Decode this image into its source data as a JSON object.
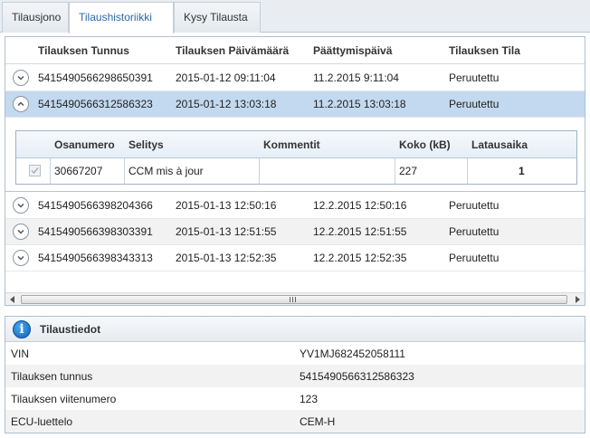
{
  "tabs": [
    {
      "label": "Tilausjono"
    },
    {
      "label": "Tilaushistoriikki"
    },
    {
      "label": "Kysy Tilausta"
    }
  ],
  "grid": {
    "columns": [
      "Tilauksen Tunnus",
      "Tilauksen Päivämäärä",
      "Päättymispäivä",
      "Tilauksen Tila"
    ],
    "rows": [
      {
        "id": "5415490566298650391",
        "date": "2015-01-12 09:11:04",
        "end": "11.2.2015 9:11:04",
        "status": "Peruutettu"
      },
      {
        "id": "5415490566312586323",
        "date": "2015-01-12 13:03:18",
        "end": "11.2.2015 13:03:18",
        "status": "Peruutettu"
      },
      {
        "id": "5415490566398204366",
        "date": "2015-01-13 12:50:16",
        "end": "12.2.2015 12:50:16",
        "status": "Peruutettu"
      },
      {
        "id": "5415490566398303391",
        "date": "2015-01-13 12:51:55",
        "end": "12.2.2015 12:51:55",
        "status": "Peruutettu"
      },
      {
        "id": "5415490566398343313",
        "date": "2015-01-13 12:52:35",
        "end": "12.2.2015 12:52:35",
        "status": "Peruutettu"
      }
    ]
  },
  "detail": {
    "columns": [
      "Osanumero",
      "Selitys",
      "Kommentit",
      "Koko (kB)",
      "Latausaika"
    ],
    "row": {
      "part": "30667207",
      "desc": "CCM mis à jour",
      "comment": "",
      "size": "227",
      "time": "1"
    }
  },
  "info": {
    "title": "Tilaustiedot",
    "rows": [
      {
        "label": "VIN",
        "value": "YV1MJ682452058111"
      },
      {
        "label": "Tilauksen tunnus",
        "value": "5415490566312586323"
      },
      {
        "label": "Tilauksen viitenumero",
        "value": "123"
      },
      {
        "label": "ECU-luettelo",
        "value": "CEM-H"
      }
    ]
  },
  "colors": {
    "accent": "#2a6aa6",
    "selected_row": "#c3d9ef",
    "info_icon": "#1a7fd4"
  },
  "icons": [
    "chevron-down-icon",
    "chevron-up-icon",
    "checkbox-icon",
    "info-icon",
    "scroll-left-icon",
    "scroll-right-icon"
  ]
}
